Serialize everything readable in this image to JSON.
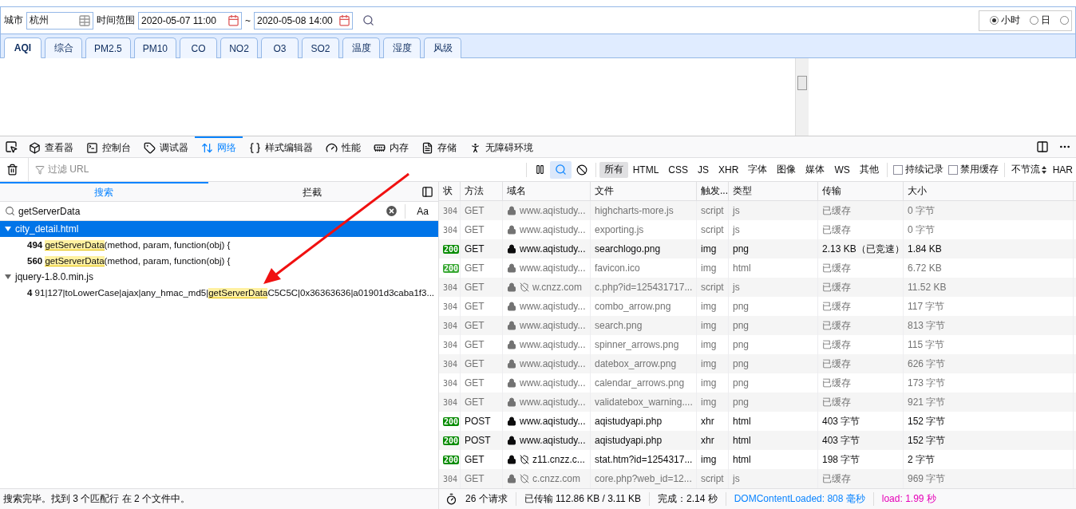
{
  "query_bar": {
    "city_label": "城市",
    "city": "杭州",
    "range_label": "时间范围",
    "start": "2020-05-07 11:00",
    "separator": "~",
    "end": "2020-05-08 14:00",
    "radios": [
      {
        "label": "小时",
        "selected": true
      },
      {
        "label": "日",
        "selected": false
      },
      {
        "selected": false
      }
    ]
  },
  "metric_tabs": [
    {
      "label": "AQI",
      "selected": true
    },
    {
      "label": "综合",
      "selected": false
    },
    {
      "label": "PM2.5",
      "selected": false
    },
    {
      "label": "PM10",
      "selected": false
    },
    {
      "label": "CO",
      "selected": false
    },
    {
      "label": "NO2",
      "selected": false
    },
    {
      "label": "O3",
      "selected": false
    },
    {
      "label": "SO2",
      "selected": false
    },
    {
      "label": "温度",
      "selected": false
    },
    {
      "label": "湿度",
      "selected": false
    },
    {
      "label": "风级",
      "selected": false
    }
  ],
  "devtools_tabs": [
    {
      "kind": "inspector",
      "label": "查看器",
      "selected": false
    },
    {
      "kind": "console",
      "label": "控制台",
      "selected": false
    },
    {
      "kind": "debugger",
      "label": "调试器",
      "selected": false
    },
    {
      "kind": "network",
      "label": "网络",
      "selected": true
    },
    {
      "kind": "style",
      "label": "样式编辑器",
      "selected": false
    },
    {
      "kind": "performance",
      "label": "性能",
      "selected": false
    },
    {
      "kind": "memory",
      "label": "内存",
      "selected": false
    },
    {
      "kind": "storage",
      "label": "存储",
      "selected": false
    },
    {
      "kind": "accessibility",
      "label": "无障碍环境",
      "selected": false
    }
  ],
  "filter_bar": {
    "placeholder": "过滤 URL",
    "search_on": true,
    "types": [
      {
        "label": "所有",
        "selected": true
      },
      {
        "label": "HTML",
        "selected": false
      },
      {
        "label": "CSS",
        "selected": false
      },
      {
        "label": "JS",
        "selected": false
      },
      {
        "label": "XHR",
        "selected": false
      },
      {
        "label": "字体",
        "selected": false
      },
      {
        "label": "图像",
        "selected": false
      },
      {
        "label": "媒体",
        "selected": false
      },
      {
        "label": "WS",
        "selected": false
      },
      {
        "label": "其他",
        "selected": false
      }
    ],
    "checkboxes": [
      {
        "label": "持续记录",
        "checked": false
      },
      {
        "label": "禁用缓存",
        "checked": false
      }
    ],
    "throttle": "不节流",
    "har": "HAR"
  },
  "search_panel": {
    "tabs": [
      {
        "label": "搜索",
        "selected": true
      },
      {
        "label": "拦截",
        "selected": false
      }
    ],
    "query": "getServerData",
    "case_toggle": "Aa",
    "results": [
      {
        "file": "city_detail.html",
        "expanded": true,
        "selected": true,
        "children": [
          {
            "line": "494",
            "match": "getServerData",
            "after": "(method, param, function(obj) {"
          },
          {
            "line": "560",
            "match": "getServerData",
            "after": "(method, param, function(obj) {"
          }
        ]
      },
      {
        "file": "jquery-1.8.0.min.js",
        "expanded": true,
        "selected": false,
        "children": [
          {
            "line": "4",
            "before": "91|127|toLowerCase|ajax|any_hmac_md5|",
            "match": "getServerData",
            "after": "C5C5C|0x36363636|a01901d3caba1f3..."
          }
        ]
      }
    ],
    "status": "搜索完毕。找到 3 个匹配行 在 2 个文件中。"
  },
  "requests": {
    "columns": [
      "状",
      "方法",
      "域名",
      "文件",
      "触发...",
      "类型",
      "传输",
      "大小"
    ],
    "rows": [
      {
        "status": "304",
        "badge": false,
        "fresh": false,
        "tracker": false,
        "method": "GET",
        "domain": "www.aqistudy...",
        "file": "highcharts-more.js",
        "trigger": "script",
        "type": "js",
        "transfer": "已缓存",
        "size": "0 字节"
      },
      {
        "status": "304",
        "badge": false,
        "fresh": false,
        "tracker": false,
        "method": "GET",
        "domain": "www.aqistudy...",
        "file": "exporting.js",
        "trigger": "script",
        "type": "js",
        "transfer": "已缓存",
        "size": "0 字节"
      },
      {
        "status": "200",
        "badge": true,
        "fresh": true,
        "tracker": false,
        "method": "GET",
        "domain": "www.aqistudy...",
        "file": "searchlogo.png",
        "trigger": "img",
        "type": "png",
        "transfer": "2.13 KB（已竞速）",
        "size": "1.84 KB"
      },
      {
        "status": "200",
        "badge": true,
        "fresh": false,
        "tracker": false,
        "method": "GET",
        "domain": "www.aqistudy...",
        "file": "favicon.ico",
        "trigger": "img",
        "type": "html",
        "transfer": "已缓存",
        "size": "6.72 KB"
      },
      {
        "status": "304",
        "badge": false,
        "fresh": false,
        "tracker": true,
        "method": "GET",
        "domain": "w.cnzz.com",
        "file": "c.php?id=125431717...",
        "trigger": "script",
        "type": "js",
        "transfer": "已缓存",
        "size": "11.52 KB"
      },
      {
        "status": "304",
        "badge": false,
        "fresh": false,
        "tracker": false,
        "method": "GET",
        "domain": "www.aqistudy...",
        "file": "combo_arrow.png",
        "trigger": "img",
        "type": "png",
        "transfer": "已缓存",
        "size": "117 字节"
      },
      {
        "status": "304",
        "badge": false,
        "fresh": false,
        "tracker": false,
        "method": "GET",
        "domain": "www.aqistudy...",
        "file": "search.png",
        "trigger": "img",
        "type": "png",
        "transfer": "已缓存",
        "size": "813 字节"
      },
      {
        "status": "304",
        "badge": false,
        "fresh": false,
        "tracker": false,
        "method": "GET",
        "domain": "www.aqistudy...",
        "file": "spinner_arrows.png",
        "trigger": "img",
        "type": "png",
        "transfer": "已缓存",
        "size": "115 字节"
      },
      {
        "status": "304",
        "badge": false,
        "fresh": false,
        "tracker": false,
        "method": "GET",
        "domain": "www.aqistudy...",
        "file": "datebox_arrow.png",
        "trigger": "img",
        "type": "png",
        "transfer": "已缓存",
        "size": "626 字节"
      },
      {
        "status": "304",
        "badge": false,
        "fresh": false,
        "tracker": false,
        "method": "GET",
        "domain": "www.aqistudy...",
        "file": "calendar_arrows.png",
        "trigger": "img",
        "type": "png",
        "transfer": "已缓存",
        "size": "173 字节"
      },
      {
        "status": "304",
        "badge": false,
        "fresh": false,
        "tracker": false,
        "method": "GET",
        "domain": "www.aqistudy...",
        "file": "validatebox_warning....",
        "trigger": "img",
        "type": "png",
        "transfer": "已缓存",
        "size": "921 字节"
      },
      {
        "status": "200",
        "badge": true,
        "fresh": true,
        "tracker": false,
        "method": "POST",
        "domain": "www.aqistudy...",
        "file": "aqistudyapi.php",
        "trigger": "xhr",
        "type": "html",
        "transfer": "403 字节",
        "size": "152 字节"
      },
      {
        "status": "200",
        "badge": true,
        "fresh": true,
        "tracker": false,
        "method": "POST",
        "domain": "www.aqistudy...",
        "file": "aqistudyapi.php",
        "trigger": "xhr",
        "type": "html",
        "transfer": "403 字节",
        "size": "152 字节"
      },
      {
        "status": "200",
        "badge": true,
        "fresh": true,
        "tracker": true,
        "method": "GET",
        "domain": "z11.cnzz.c...",
        "file": "stat.htm?id=1254317...",
        "trigger": "img",
        "type": "html",
        "transfer": "198 字节",
        "size": "2 字节"
      },
      {
        "status": "304",
        "badge": false,
        "fresh": false,
        "tracker": true,
        "method": "GET",
        "domain": "c.cnzz.com",
        "file": "core.php?web_id=12...",
        "trigger": "script",
        "type": "js",
        "transfer": "已缓存",
        "size": "969 字节"
      }
    ]
  },
  "summary": [
    {
      "text": "26 个请求",
      "color": "#0c0c0d"
    },
    {
      "text": "已传输 112.86 KB / 3.11 KB",
      "color": "#0c0c0d"
    },
    {
      "text": "完成：2.14 秒",
      "color": "#0c0c0d"
    },
    {
      "text": "DOMContentLoaded: 808 毫秒",
      "color": "#0a84ff"
    },
    {
      "text": "load: 1.99 秒",
      "color": "#e600b8"
    }
  ]
}
